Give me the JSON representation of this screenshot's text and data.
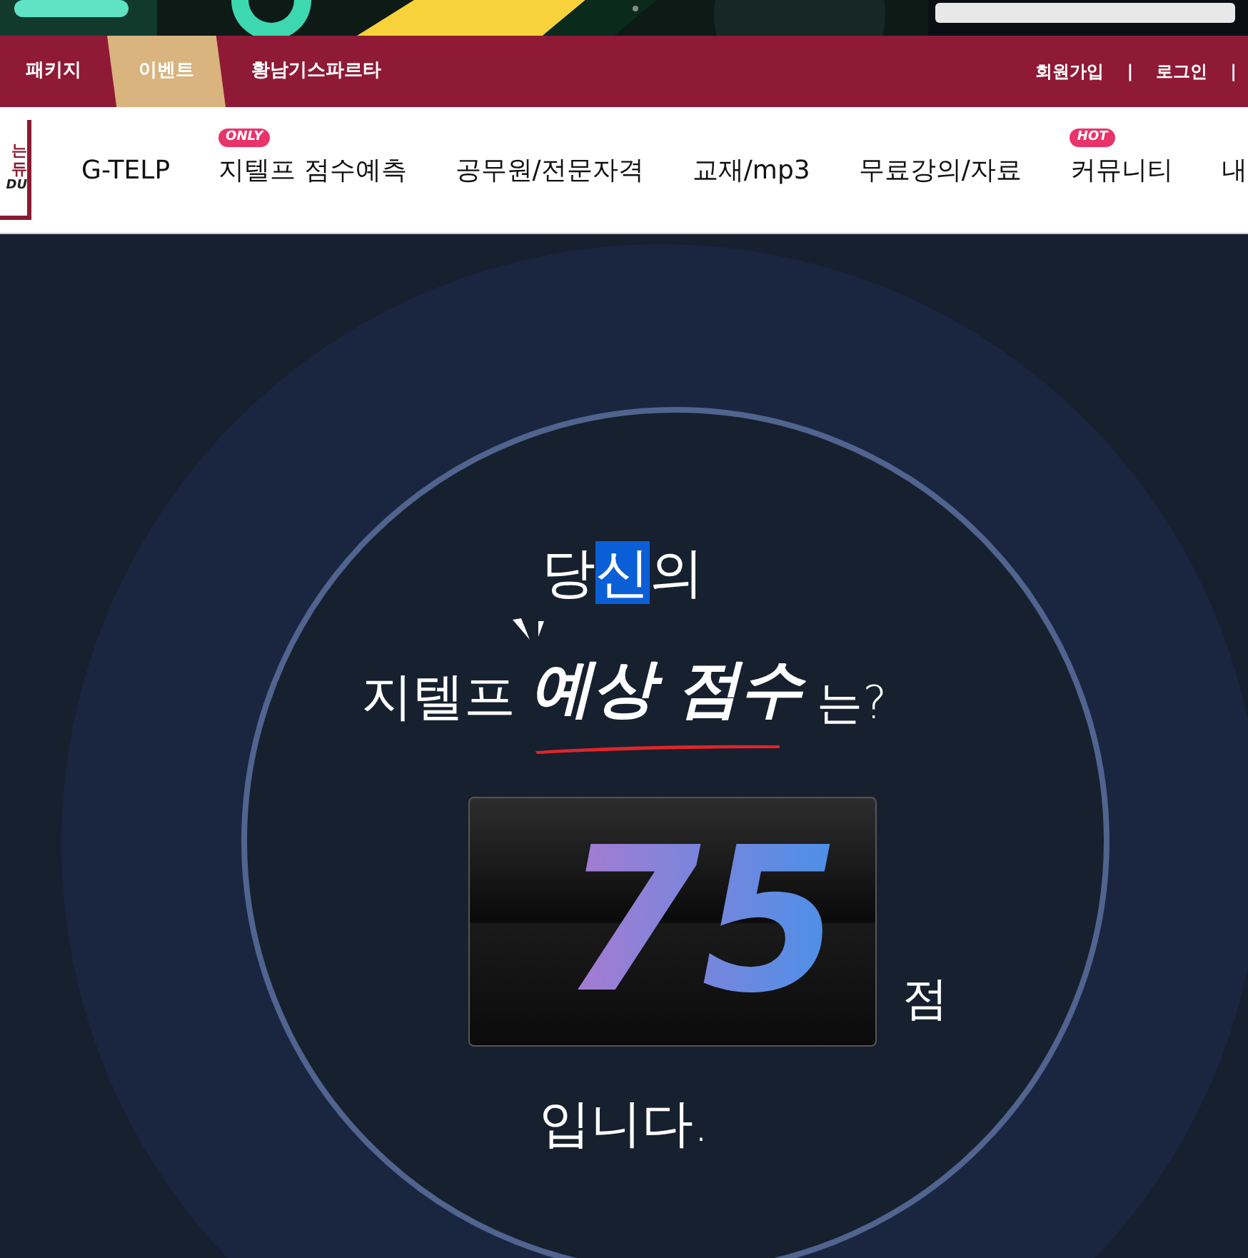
{
  "top_bar": {
    "tabs": [
      {
        "label": "패키지",
        "selected": false
      },
      {
        "label": "이벤트",
        "selected": true
      },
      {
        "label": "황남기스파르타",
        "selected": false
      }
    ],
    "account_links": [
      {
        "label": "회원가입",
        "separator": "|"
      },
      {
        "label": "로그인",
        "separator": "|"
      }
    ]
  },
  "logo": {
    "lines": [
      "는",
      "듀",
      "DU"
    ]
  },
  "nav": {
    "items": [
      {
        "label": "G-TELP"
      },
      {
        "label": "지텔프 점수예측",
        "badge": "ONLY"
      },
      {
        "label": "공무원/전문자격"
      },
      {
        "label": "교재/mp3"
      },
      {
        "label": "무료강의/자료"
      },
      {
        "label": "커뮤니티",
        "badge": "HOT"
      },
      {
        "label": "내"
      }
    ]
  },
  "result": {
    "line1": [
      {
        "text": "당",
        "selected": false
      },
      {
        "text": "신",
        "selected": true
      },
      {
        "text": "의",
        "selected": false
      }
    ],
    "prefix": "지텔프",
    "emphasis": "예상 점수",
    "suffix": "는?",
    "score": "75",
    "unit": "점",
    "closing": "입니다."
  }
}
